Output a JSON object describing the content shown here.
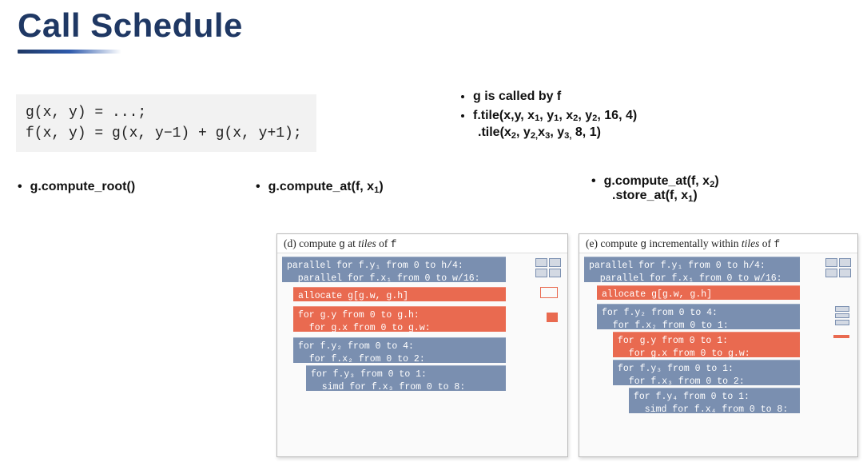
{
  "title": "Call Schedule",
  "code": "g(x, y) = ...;\nf(x, y) = g(x, y−1) + g(x, y+1);",
  "notes": {
    "line1": "g  is called by f",
    "line2_html": "f.tile(x,y, x<sub>1</sub>, y<sub>1</sub>, x<sub>2</sub>, y<sub>2</sub>, 16, 4)",
    "line3_html": ".tile(x<sub>2</sub>, y<sub>2,</sub>x<sub>3</sub>, y<sub>3,</sub> 8, 1)"
  },
  "bullets": {
    "b1": "g.compute_root()",
    "b2_html": "g.compute_at(f, x<sub>1</sub>)",
    "b3a_html": "g.compute_at(f, x<sub>2</sub>)",
    "b3b_html": ".store_at(f, x<sub>1</sub>)"
  },
  "panel_d": {
    "header_prefix": "(d) compute ",
    "header_g": "g",
    "header_mid": " at ",
    "header_em": "tiles",
    "header_of": " of ",
    "header_f": "f",
    "blk1": "parallel for f.y₁ from 0 to h/4:\n  parallel for f.x₁ from 0 to w/16:",
    "blk2": "allocate g[g.w, g.h]",
    "blk3": "for g.y from 0 to g.h:\n  for g.x from 0 to g.w:",
    "blk4": "for f.y₂ from 0 to 4:\n  for f.x₂ from 0 to 2:",
    "blk5": "for f.y₃ from 0 to 1:\n  simd for f.x₃ from 0 to 8:"
  },
  "panel_e": {
    "header_prefix": "(e) compute ",
    "header_g": "g",
    "header_mid": " incrementally within ",
    "header_em": "tiles",
    "header_of": " of ",
    "header_f": "f",
    "blk1": "parallel for f.y₁ from 0 to h/4:\n  parallel for f.x₁ from 0 to w/16:",
    "blk2": "allocate g[g.w, g.h]",
    "blk3": "for f.y₂ from 0 to 4:\n  for f.x₂ from 0 to 1:",
    "blk4": "for g.y from 0 to 1:\n  for g.x from 0 to g.w:",
    "blk5": "for f.y₃ from 0 to 1:\n  for f.x₃ from 0 to 2:",
    "blk6": "for f.y₄ from 0 to 1:\n  simd for f.x₄ from 0 to 8:"
  }
}
